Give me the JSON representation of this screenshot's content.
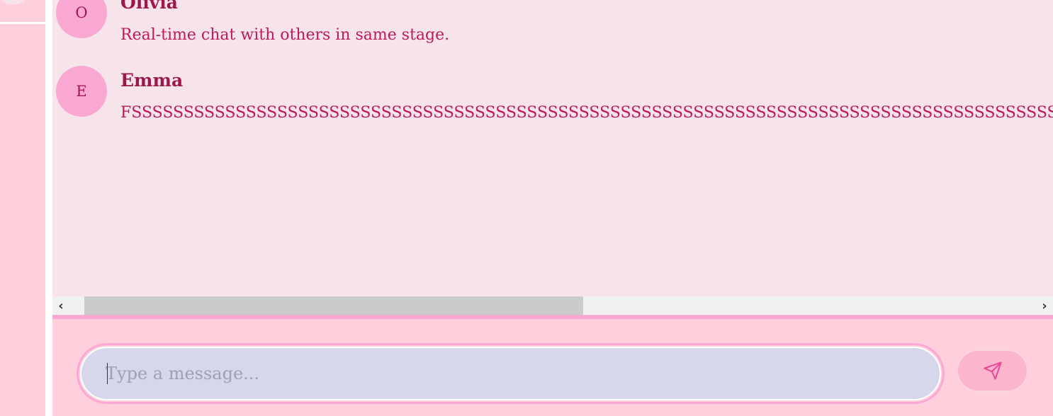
{
  "messages": [
    {
      "avatar_initial": "O",
      "author": "Olivia",
      "text": "Real-time chat with others in same stage."
    },
    {
      "avatar_initial": "E",
      "author": "Emma",
      "text": "FSSSSSSSSSSSSSSSSSSSSSSSSSSSSSSSSSSSSSSSSSSSSSSSSSSSSSSSSSSSSSSSSSSSSSSSSSSSSSSSSSSSSSSSSSSSSSSSSSSSSSS"
    }
  ],
  "composer": {
    "placeholder": "Type a message...",
    "send_icon": "send-icon"
  },
  "scrollbar": {
    "left_arrow": "‹",
    "right_arrow": "›"
  },
  "colors": {
    "background": "#ffd0dc",
    "chat_background": "#f7e4ea",
    "accent": "#f9a8d4",
    "author": "#9d174d",
    "text": "#be185d",
    "input_background": "#d6d7ea"
  }
}
